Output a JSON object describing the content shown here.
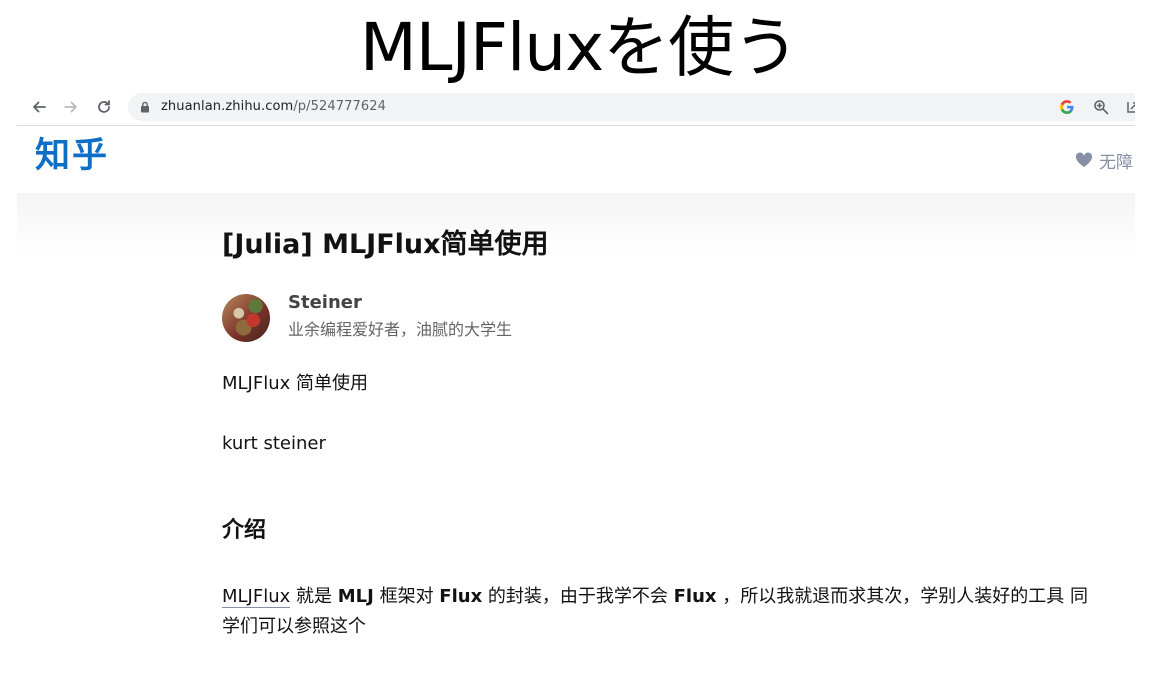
{
  "slide_title": "MLJFluxを使う",
  "browser": {
    "url_domain": "zhuanlan.zhihu.com",
    "url_path": "/p/524777624",
    "icons": [
      "back-arrow-icon",
      "forward-arrow-icon",
      "reload-icon",
      "lock-icon",
      "google-icon",
      "zoom-icon",
      "share-icon"
    ]
  },
  "site": {
    "logo": "知乎",
    "header_right_text": "无障"
  },
  "article": {
    "title": "[Julia] MLJFlux简单使用",
    "author_name": "Steiner",
    "author_bio": "业余编程爱好者，油腻的大学生",
    "intro_line": "MLJFlux 简单使用",
    "byline": "kurt steiner",
    "section_heading": "介绍",
    "body": {
      "link": "MLJFlux",
      "t1": " 就是 ",
      "b1": "MLJ",
      "t2": " 框架对 ",
      "b2": "Flux",
      "t3": " 的封装，由于我学不会 ",
      "b3": "Flux",
      "t4": " ，所以我就退而求其次，学别人装好的工具 同学们可以参照这个"
    }
  },
  "colors": {
    "logo_blue": "#0f6fc6",
    "muted_gray": "#8590a6",
    "address_bar_bg": "#f1f3f4"
  }
}
